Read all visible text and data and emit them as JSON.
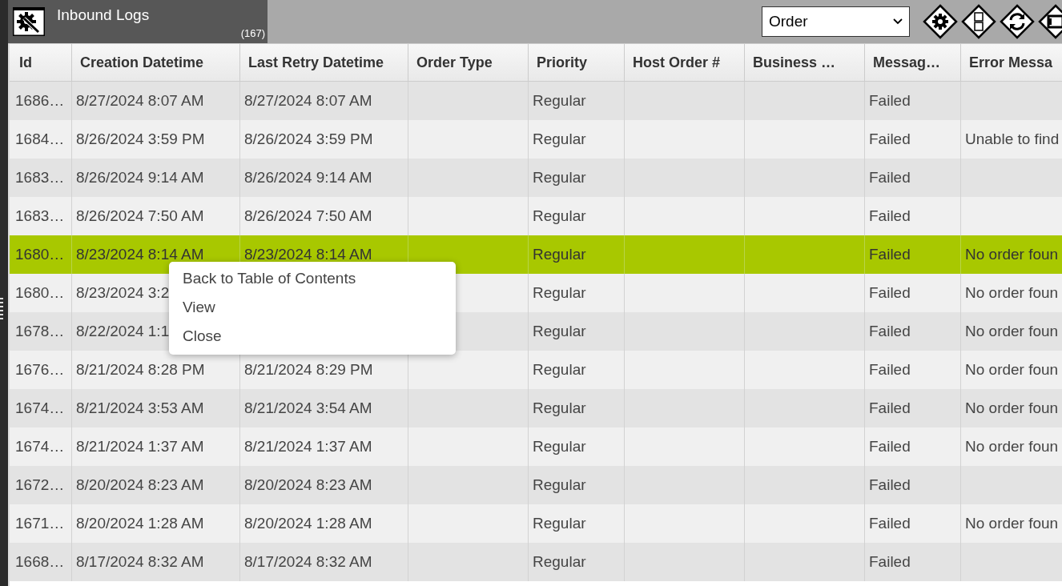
{
  "panel": {
    "title": "Inbound Logs",
    "count": "(167)"
  },
  "filter": {
    "value": "Order"
  },
  "table": {
    "columns": [
      "Id",
      "Creation Datetime",
      "Last Retry Datetime",
      "Order Type",
      "Priority",
      "Host Order #",
      "Business …",
      "Messag…",
      "Error Messa"
    ],
    "rows": [
      {
        "id": "1686…",
        "created": "8/27/2024 8:07 AM",
        "retried": "8/27/2024 8:07 AM",
        "priority": "Regular",
        "status": "Failed",
        "selected": false
      },
      {
        "id": "1684…",
        "created": "8/26/2024 3:59 PM",
        "retried": "8/26/2024 3:59 PM",
        "priority": "Regular",
        "status": "Failed",
        "error": "Unable to find",
        "selected": false
      },
      {
        "id": "1683…",
        "created": "8/26/2024 9:14 AM",
        "retried": "8/26/2024 9:14 AM",
        "priority": "Regular",
        "status": "Failed",
        "selected": false
      },
      {
        "id": "1683…",
        "created": "8/26/2024 7:50 AM",
        "retried": "8/26/2024 7:50 AM",
        "priority": "Regular",
        "status": "Failed",
        "selected": false
      },
      {
        "id": "1680…",
        "created": "8/23/2024 8:14 AM",
        "retried": "8/23/2024 8:14 AM",
        "priority": "Regular",
        "status": "Failed",
        "error": "No order foun",
        "selected": true
      },
      {
        "id": "1680…",
        "created": "8/23/2024 3:2",
        "priority": "Regular",
        "status": "Failed",
        "error": "No order foun",
        "selected": false
      },
      {
        "id": "1678…",
        "created": "8/22/2024 1:1",
        "priority": "Regular",
        "status": "Failed",
        "error": "No order foun",
        "selected": false
      },
      {
        "id": "1676…",
        "created": "8/21/2024 8:28 PM",
        "retried": "8/21/2024 8:29 PM",
        "priority": "Regular",
        "status": "Failed",
        "error": "No order foun",
        "selected": false
      },
      {
        "id": "1674…",
        "created": "8/21/2024 3:53 AM",
        "retried": "8/21/2024 3:54 AM",
        "priority": "Regular",
        "status": "Failed",
        "error": "No order foun",
        "selected": false
      },
      {
        "id": "1674…",
        "created": "8/21/2024 1:37 AM",
        "retried": "8/21/2024 1:37 AM",
        "priority": "Regular",
        "status": "Failed",
        "error": "No order foun",
        "selected": false
      },
      {
        "id": "1672…",
        "created": "8/20/2024 8:23 AM",
        "retried": "8/20/2024 8:23 AM",
        "priority": "Regular",
        "status": "Failed",
        "selected": false
      },
      {
        "id": "1671…",
        "created": "8/20/2024 1:28 AM",
        "retried": "8/20/2024 1:28 AM",
        "priority": "Regular",
        "status": "Failed",
        "error": "No order foun",
        "selected": false
      },
      {
        "id": "1668…",
        "created": "8/17/2024 8:32 AM",
        "retried": "8/17/2024 8:32 AM",
        "priority": "Regular",
        "status": "Failed",
        "selected": false
      }
    ]
  },
  "context_menu": {
    "items": [
      "Back to Table of Contents",
      "View",
      "Close"
    ]
  }
}
